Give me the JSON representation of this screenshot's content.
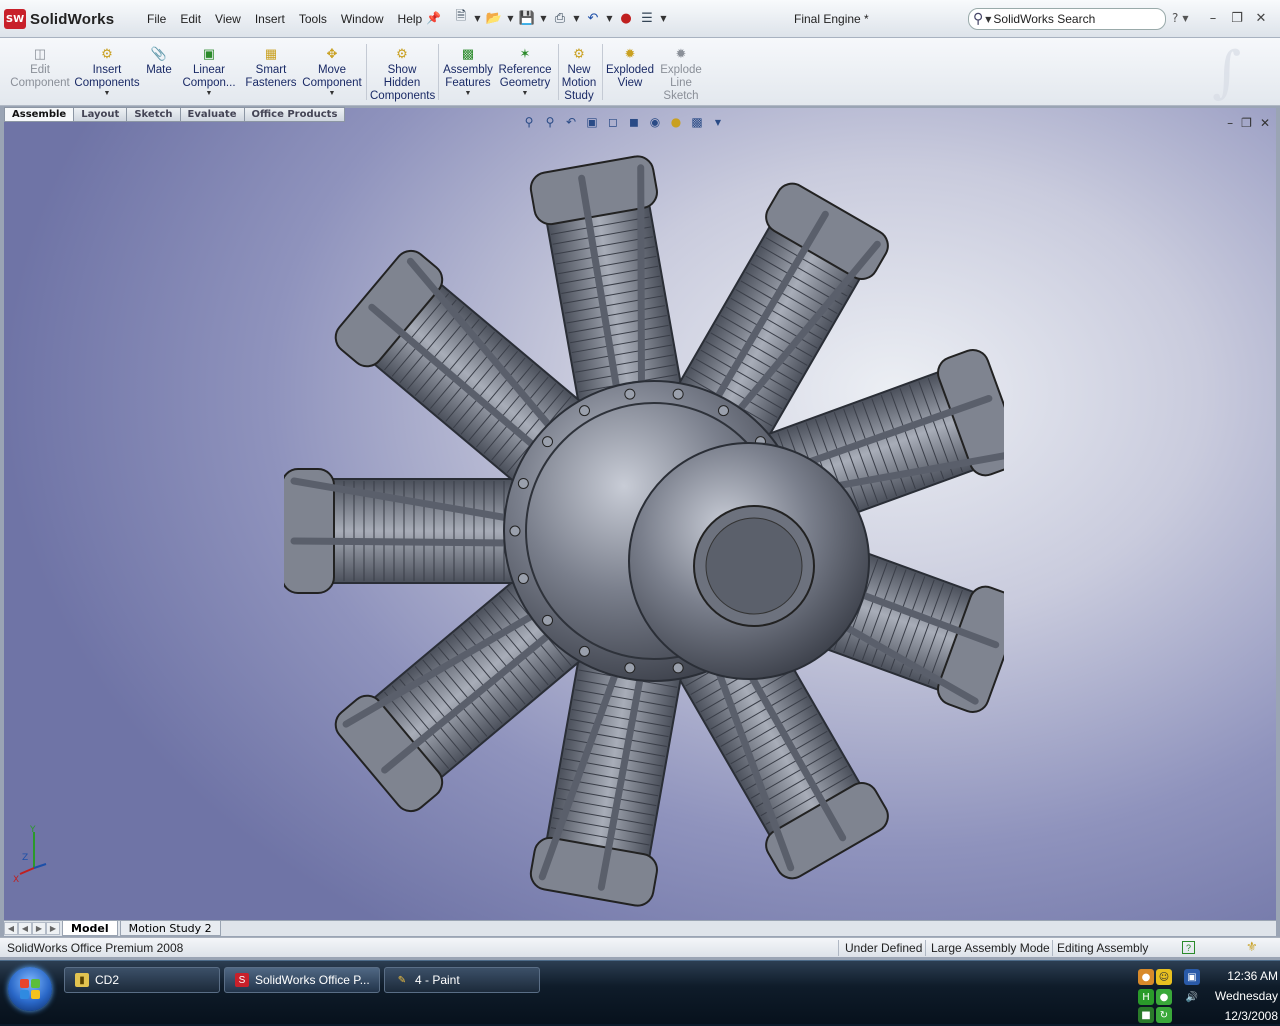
{
  "app": {
    "logo_text": "SolidWorks",
    "document_title": "Final Engine *"
  },
  "menu": [
    "File",
    "Edit",
    "View",
    "Insert",
    "Tools",
    "Window",
    "Help"
  ],
  "search": {
    "placeholder": "SolidWorks Search",
    "value": "SolidWorks Search"
  },
  "command_manager": {
    "edit_component": "Edit\nComponent",
    "insert_components": "Insert\nComponents",
    "mate": "Mate",
    "linear_component": "Linear\nCompon...",
    "smart_fasteners": "Smart\nFasteners",
    "move_component": "Move\nComponent",
    "show_hidden": "Show\nHidden\nComponents",
    "assembly_features": "Assembly\nFeatures",
    "reference_geometry": "Reference\nGeometry",
    "new_motion_study": "New\nMotion\nStudy",
    "exploded_view": "Exploded\nView",
    "explode_line_sketch": "Explode\nLine\nSketch"
  },
  "tabs": [
    "Assemble",
    "Layout",
    "Sketch",
    "Evaluate",
    "Office Products"
  ],
  "bottom_tabs": [
    "Model",
    "Motion Study 2"
  ],
  "status": {
    "product": "SolidWorks Office Premium 2008",
    "definition": "Under Defined",
    "mode": "Large Assembly Mode",
    "editing": "Editing Assembly"
  },
  "taskbar": {
    "items": [
      "CD2",
      "SolidWorks Office P...",
      "4 - Paint"
    ],
    "time": "12:36 AM",
    "day": "Wednesday",
    "date": "12/3/2008"
  },
  "triad": {
    "y": "Y",
    "z": "Z",
    "x": "X"
  }
}
